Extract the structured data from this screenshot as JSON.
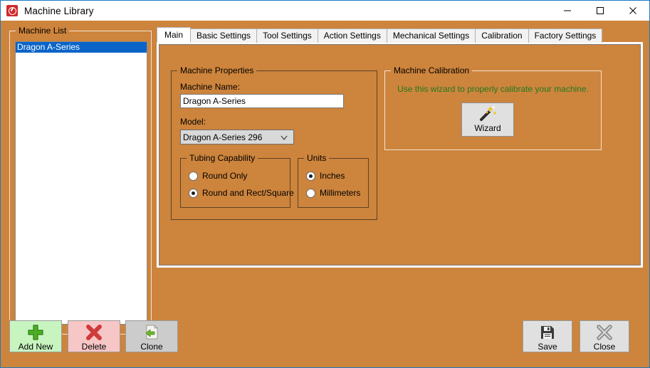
{
  "window": {
    "title": "Machine Library",
    "app_icon": "machine-library-logo-icon",
    "minimize_label": "minimize-icon",
    "maximize_label": "maximize-icon",
    "close_label": "close-icon",
    "background_color": "#cd843c",
    "border_color": "#1b7ac4"
  },
  "machine_list": {
    "group_title": "Machine List",
    "items": [
      {
        "label": "Dragon A-Series",
        "selected": true
      }
    ],
    "selection_color": "#0a64c8"
  },
  "tabs": [
    {
      "label": "Main",
      "active": true
    },
    {
      "label": "Basic Settings",
      "active": false
    },
    {
      "label": "Tool Settings",
      "active": false
    },
    {
      "label": "Action Settings",
      "active": false
    },
    {
      "label": "Mechanical Settings",
      "active": false
    },
    {
      "label": "Calibration",
      "active": false
    },
    {
      "label": "Factory Settings",
      "active": false
    }
  ],
  "machine_properties": {
    "group_title": "Machine Properties",
    "machine_name_label": "Machine Name:",
    "machine_name_value": "Dragon A-Series",
    "machine_name_placeholder": "",
    "model_label": "Model:",
    "model_value": "Dragon A-Series 296",
    "model_arrow_icon": "chevron-down-icon",
    "tubing": {
      "group_title": "Tubing Capability",
      "options": [
        {
          "label": "Round Only",
          "checked": false
        },
        {
          "label": "Round and Rect/Square",
          "checked": true
        }
      ]
    },
    "units": {
      "group_title": "Units",
      "options": [
        {
          "label": "Inches",
          "checked": true
        },
        {
          "label": "Millimeters",
          "checked": false
        }
      ]
    }
  },
  "calibration": {
    "group_title": "Machine Calibration",
    "hint_text": "Use this wizard to properly calibrate your machine.",
    "hint_color": "#1f7a1f",
    "wizard_button_label": "Wizard",
    "wizard_icon": "magic-wand-icon"
  },
  "actions": {
    "add_new": {
      "label": "Add New",
      "icon": "plus-icon",
      "color": "#c8f4c0"
    },
    "delete": {
      "label": "Delete",
      "icon": "x-cross-icon",
      "color": "#f7c6c6"
    },
    "clone": {
      "label": "Clone",
      "icon": "copy-document-icon",
      "color": "#cccccc"
    },
    "save": {
      "label": "Save",
      "icon": "floppy-disk-icon",
      "color": "#e0e0e0"
    },
    "close": {
      "label": "Close",
      "icon": "x-close-icon",
      "color": "#e0e0e0"
    }
  }
}
